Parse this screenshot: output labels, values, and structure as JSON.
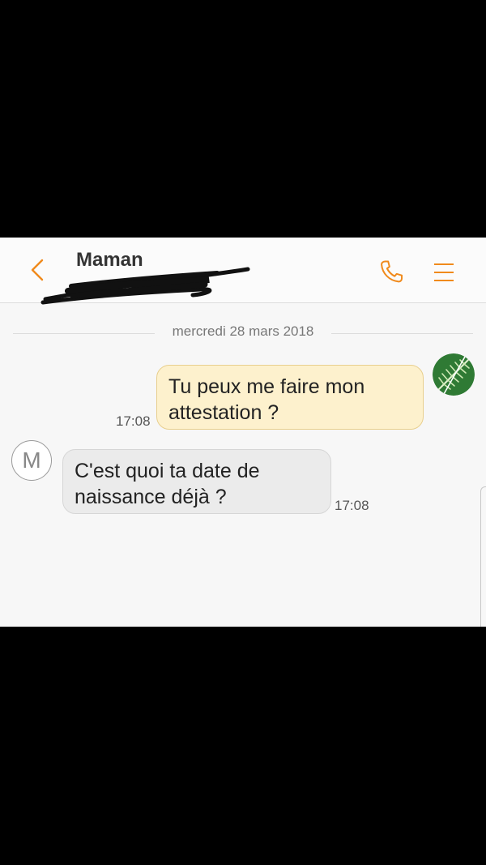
{
  "header": {
    "contact_name": "Maman",
    "back_icon": "chevron-left-icon",
    "call_icon": "phone-icon",
    "menu_icon": "hamburger-menu-icon"
  },
  "conversation": {
    "date_separator": "mercredi 28 mars 2018",
    "messages": [
      {
        "direction": "outgoing",
        "lines": [
          "Tu peux me faire mon",
          "attestation ?"
        ],
        "time": "17:08"
      },
      {
        "direction": "incoming",
        "lines": [
          "C'est quoi ta date de",
          "naissance déjà ?"
        ],
        "time": "17:08",
        "avatar_initial": "M"
      }
    ]
  },
  "colors": {
    "accent": "#f08a1c",
    "outgoing_bubble": "#fdf1cd",
    "incoming_bubble": "#ebebeb",
    "background": "#f7f7f7"
  }
}
